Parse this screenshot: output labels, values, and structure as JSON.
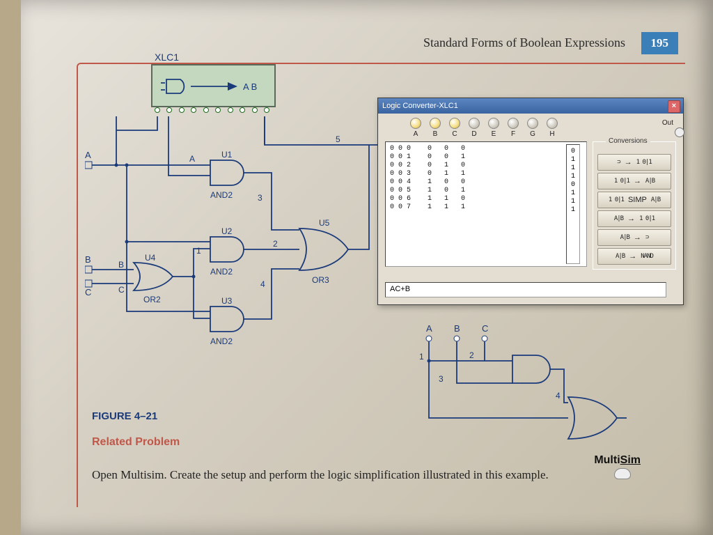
{
  "header": {
    "title": "Standard Forms of Boolean Expressions",
    "page": "195"
  },
  "xlc": {
    "ref": "XLC1",
    "inner": "A B"
  },
  "circuit": {
    "inputs": [
      "A",
      "B",
      "C"
    ],
    "gates": {
      "U1": {
        "type": "AND2",
        "label": "U1"
      },
      "U2": {
        "type": "AND2",
        "label": "U2"
      },
      "U3": {
        "type": "AND2",
        "label": "U3"
      },
      "U4": {
        "type": "OR2",
        "label": "U4"
      },
      "U5": {
        "type": "OR3",
        "label": "U5"
      }
    },
    "net_labels": {
      "n1": "1",
      "n2": "2",
      "n3": "3",
      "n4": "4",
      "n5": "5"
    },
    "pin_labels": {
      "A": "A",
      "B": "B",
      "C": "C"
    }
  },
  "window": {
    "title": "Logic Converter-XLC1",
    "columns": [
      "A",
      "B",
      "C",
      "D",
      "E",
      "F",
      "G",
      "H"
    ],
    "out_label": "Out",
    "truth_rows": [
      {
        "idx": "0 0 0",
        "bits": "0   0   0",
        "out": "0"
      },
      {
        "idx": "0 0 1",
        "bits": "0   0   1",
        "out": "1"
      },
      {
        "idx": "0 0 2",
        "bits": "0   1   0",
        "out": "1"
      },
      {
        "idx": "0 0 3",
        "bits": "0   1   1",
        "out": "1"
      },
      {
        "idx": "0 0 4",
        "bits": "1   0   0",
        "out": "0"
      },
      {
        "idx": "0 0 5",
        "bits": "1   0   1",
        "out": "1"
      },
      {
        "idx": "0 0 6",
        "bits": "1   1   0",
        "out": "1"
      },
      {
        "idx": "0 0 7",
        "bits": "1   1   1",
        "out": "1"
      }
    ],
    "conversions_caption": "Conversions",
    "buttons": [
      {
        "l": "⊃",
        "m": "→",
        "r": "1 0|1"
      },
      {
        "l": "1 0|1",
        "m": "→",
        "r": "A|B"
      },
      {
        "l": "1 0|1",
        "m": "SIMP",
        "r": "A|B"
      },
      {
        "l": "A|B",
        "m": "→",
        "r": "1 0|1"
      },
      {
        "l": "A|B",
        "m": "→",
        "r": "⊃"
      },
      {
        "l": "A|B",
        "m": "→",
        "r": "NAND"
      }
    ],
    "expression": "AC+B"
  },
  "mini": {
    "inputs": [
      "A",
      "B",
      "C"
    ],
    "nets": [
      "1",
      "2",
      "3",
      "4"
    ]
  },
  "figure": "FIGURE 4–21",
  "related_heading": "Related Problem",
  "related_body": "Open Multisim. Create the setup and perform the logic simplification illustrated in this example.",
  "multisim": "MultiSim"
}
